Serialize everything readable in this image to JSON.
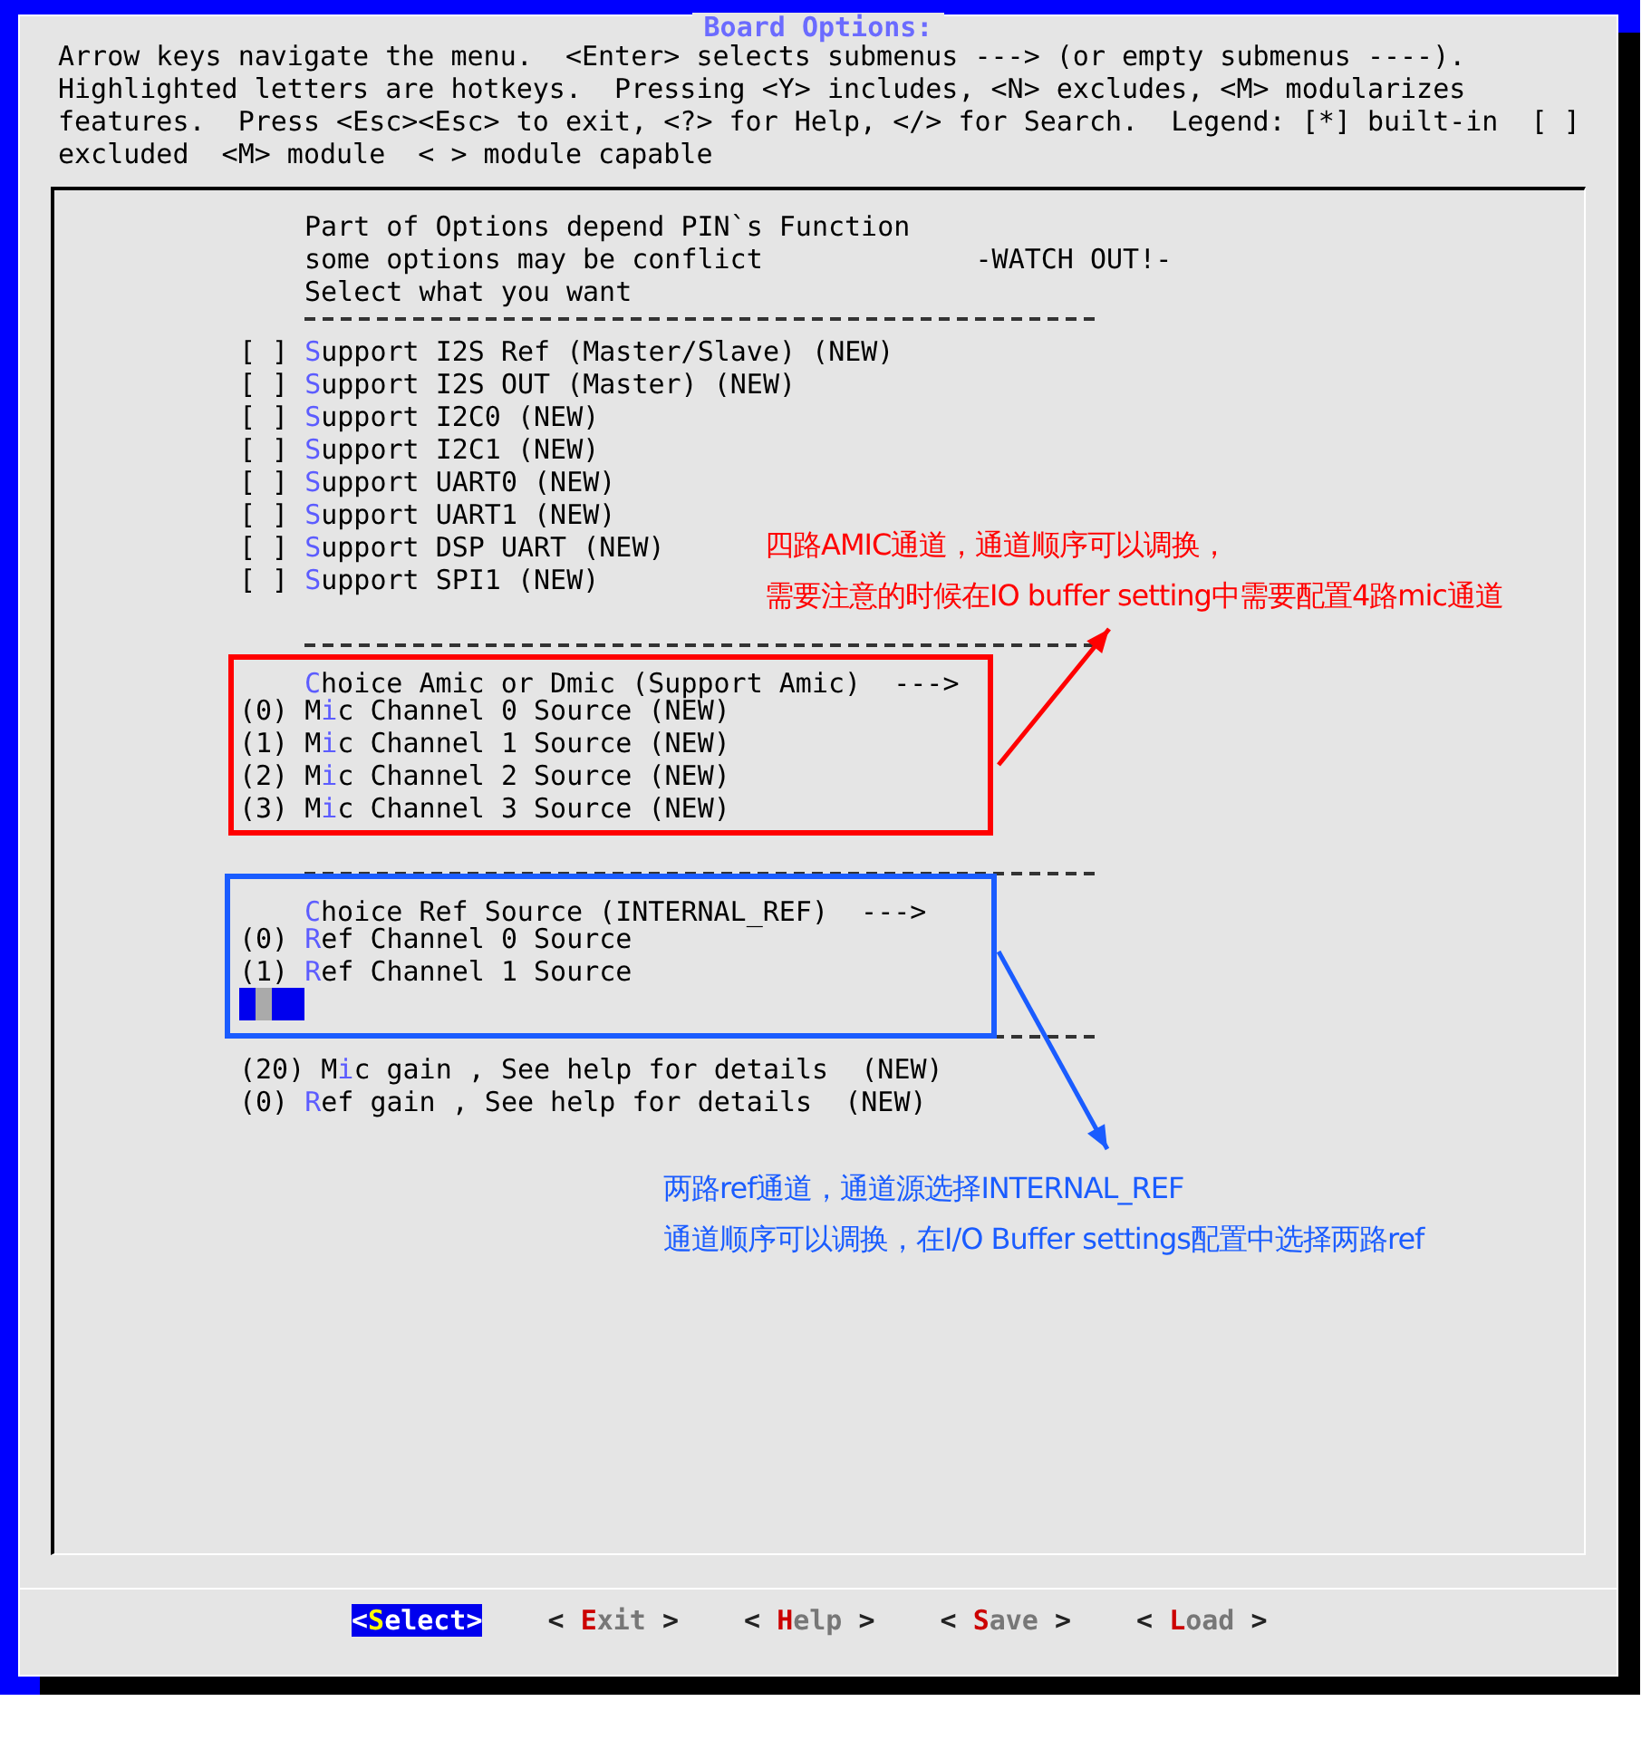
{
  "dialog": {
    "title": "Board Options:",
    "help_lines": [
      "Arrow keys navigate the menu.  <Enter> selects submenus ---> (or empty submenus ----).",
      "Highlighted letters are hotkeys.  Pressing <Y> includes, <N> excludes, <M> modularizes",
      "features.  Press <Esc><Esc> to exit, <?> for Help, </> for Search.  Legend: [*] built-in  [ ]",
      "excluded  <M> module  < > module capable"
    ],
    "menu": [
      {
        "kind": "comment",
        "text": "Part of Options depend PIN`s Function"
      },
      {
        "kind": "comment",
        "text": "some options may be conflict             -WATCH OUT!-"
      },
      {
        "kind": "comment",
        "text": "Select what you want"
      },
      {
        "kind": "separator"
      },
      {
        "kind": "bool",
        "box": "[ ]",
        "checked": false,
        "hot": "S",
        "post": "upport I2S Ref (Master/Slave) (NEW)"
      },
      {
        "kind": "bool",
        "box": "[ ]",
        "checked": false,
        "hot": "S",
        "post": "upport I2S OUT (Master) (NEW)"
      },
      {
        "kind": "bool",
        "box": "[ ]",
        "checked": false,
        "hot": "S",
        "post": "upport I2C0 (NEW)"
      },
      {
        "kind": "bool",
        "box": "[ ]",
        "checked": false,
        "hot": "S",
        "post": "upport I2C1 (NEW)"
      },
      {
        "kind": "bool",
        "box": "[ ]",
        "checked": false,
        "hot": "S",
        "post": "upport UART0 (NEW)"
      },
      {
        "kind": "bool",
        "box": "[ ]",
        "checked": false,
        "hot": "S",
        "post": "upport UART1 (NEW)"
      },
      {
        "kind": "bool",
        "box": "[ ]",
        "checked": false,
        "hot": "S",
        "post": "upport DSP UART (NEW)"
      },
      {
        "kind": "bool",
        "box": "[ ]",
        "checked": false,
        "hot": "S",
        "post": "upport SPI1 (NEW)"
      },
      {
        "kind": "blank"
      },
      {
        "kind": "separator"
      },
      {
        "kind": "choice",
        "hot": "C",
        "post": "hoice Amic or Dmic (Support Amic)  --->"
      },
      {
        "kind": "value",
        "value": "(0)",
        "pre": "M",
        "hot": "i",
        "post": "c Channel 0 Source (NEW)"
      },
      {
        "kind": "value",
        "value": "(1)",
        "pre": "M",
        "hot": "i",
        "post": "c Channel 1 Source (NEW)"
      },
      {
        "kind": "value",
        "value": "(2)",
        "pre": "M",
        "hot": "i",
        "post": "c Channel 2 Source (NEW)"
      },
      {
        "kind": "value",
        "value": "(3)",
        "pre": "M",
        "hot": "i",
        "post": "c Channel 3 Source (NEW)"
      },
      {
        "kind": "blank"
      },
      {
        "kind": "separator"
      },
      {
        "kind": "choice",
        "hot": "C",
        "post": "hoice Ref Source (INTERNAL_REF)  --->"
      },
      {
        "kind": "value",
        "value": "(0)",
        "hot": "R",
        "post": "ef Channel 0 Source"
      },
      {
        "kind": "value",
        "value": "(1)",
        "hot": "R",
        "post": "ef Channel 1 Source"
      },
      {
        "kind": "blank",
        "selected": true
      },
      {
        "kind": "separator"
      },
      {
        "kind": "value",
        "value": "(20)",
        "pre": "M",
        "hot": "i",
        "post": "c gain , See help for details  (NEW)"
      },
      {
        "kind": "value",
        "value": "(0)",
        "hot": "R",
        "post": "ef gain , See help for details  (NEW)"
      }
    ],
    "buttons": [
      {
        "left": "<",
        "hot": "S",
        "rest": "elect",
        "right": ">",
        "selected": true
      },
      {
        "left": "< ",
        "hot": "E",
        "rest": "xit",
        "right": " >",
        "selected": false
      },
      {
        "left": "< ",
        "hot": "H",
        "rest": "elp",
        "right": " >",
        "selected": false
      },
      {
        "left": "< ",
        "hot": "S",
        "rest": "ave",
        "right": " >",
        "selected": false
      },
      {
        "left": "< ",
        "hot": "L",
        "rest": "oad",
        "right": " >",
        "selected": false
      }
    ]
  },
  "annotations": [
    {
      "color": "#ff0000",
      "lines": [
        "四路AMIC通道，通道顺序可以调换，",
        "需要注意的时候在IO buffer setting中需要配置4路mic通道"
      ]
    },
    {
      "color": "#1a5cff",
      "lines": [
        "两路ref通道，通道源选择INTERNAL_REF",
        "通道顺序可以调换，在I/O Buffer settings配置中选择两路ref"
      ]
    }
  ]
}
